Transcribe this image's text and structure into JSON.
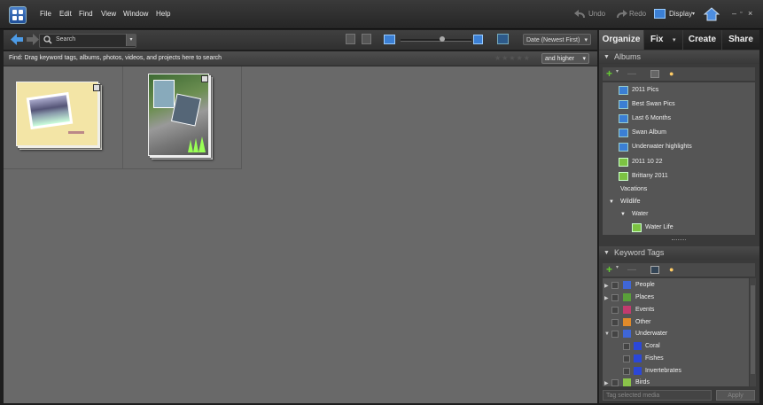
{
  "menubar": {
    "menus": [
      "File",
      "Edit",
      "Find",
      "View",
      "Window",
      "Help"
    ],
    "undo": "Undo",
    "redo": "Redo",
    "display": "Display"
  },
  "toolbar": {
    "search_placeholder": "Search",
    "sort": "Date (Newest First)"
  },
  "findbar": {
    "text": "Find: Drag keyword tags, albums, photos, videos, and projects here to search",
    "rating_filter": "and higher"
  },
  "tabs": [
    "Organize",
    "Fix",
    "Create",
    "Share"
  ],
  "albums_panel": {
    "title": "Albums",
    "items": [
      {
        "label": "2011 Pics",
        "type": "blue"
      },
      {
        "label": "Best Swan Pics",
        "type": "blue"
      },
      {
        "label": "Last 6 Months",
        "type": "blue"
      },
      {
        "label": "Swan Album",
        "type": "blue"
      },
      {
        "label": "Underwater highlights",
        "type": "blue"
      },
      {
        "label": "2011 10 22",
        "type": "green"
      },
      {
        "label": "Brittany 2011",
        "type": "green"
      },
      {
        "label": "Vacations",
        "type": "group"
      },
      {
        "label": "Wildlife",
        "type": "group"
      },
      {
        "label": "Water",
        "type": "group"
      },
      {
        "label": "Water Life",
        "type": "green"
      }
    ]
  },
  "keywords_panel": {
    "title": "Keyword Tags",
    "items": [
      {
        "label": "People",
        "color": "#3f66d6"
      },
      {
        "label": "Places",
        "color": "#5aa03a"
      },
      {
        "label": "Events",
        "color": "#c23b6e"
      },
      {
        "label": "Other",
        "color": "#e08a2a"
      },
      {
        "label": "Underwater",
        "color": "#3f66d6"
      },
      {
        "label": "Coral",
        "color": "#2b47d8"
      },
      {
        "label": "Fishes",
        "color": "#2b47d8"
      },
      {
        "label": "Invertebrates",
        "color": "#2b47d8"
      },
      {
        "label": "Birds",
        "color": "#8bc34a"
      }
    ],
    "tag_placeholder": "Tag selected media",
    "apply": "Apply"
  },
  "colors": {
    "accent_blue": "#3b7fd4",
    "album_green": "#7cc242",
    "grid_bg": "#696969"
  }
}
